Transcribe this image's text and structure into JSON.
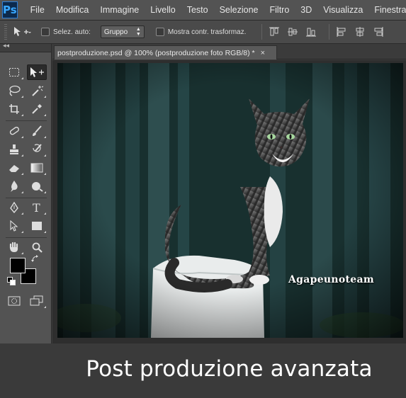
{
  "app": {
    "logo": "Ps"
  },
  "menu": [
    "File",
    "Modifica",
    "Immagine",
    "Livello",
    "Testo",
    "Selezione",
    "Filtro",
    "3D",
    "Visualizza",
    "Finestra"
  ],
  "options": {
    "auto_select_label": "Selez. auto:",
    "group_value": "Gruppo",
    "transform_label": "Mostra contr. trasformaz."
  },
  "toolbar": {
    "collapse": "◂◂"
  },
  "document": {
    "tab_title": "postproduzione.psd @ 100% (postproduzione foto RGB/8) *",
    "close": "×"
  },
  "photo": {
    "watermark": "Agapeunoteam"
  },
  "caption": "Post produzione avanzata",
  "colors": {
    "menubar": "#535353",
    "accent_logo": "#39a8ff",
    "foreground": "#000000",
    "background": "#000000"
  }
}
